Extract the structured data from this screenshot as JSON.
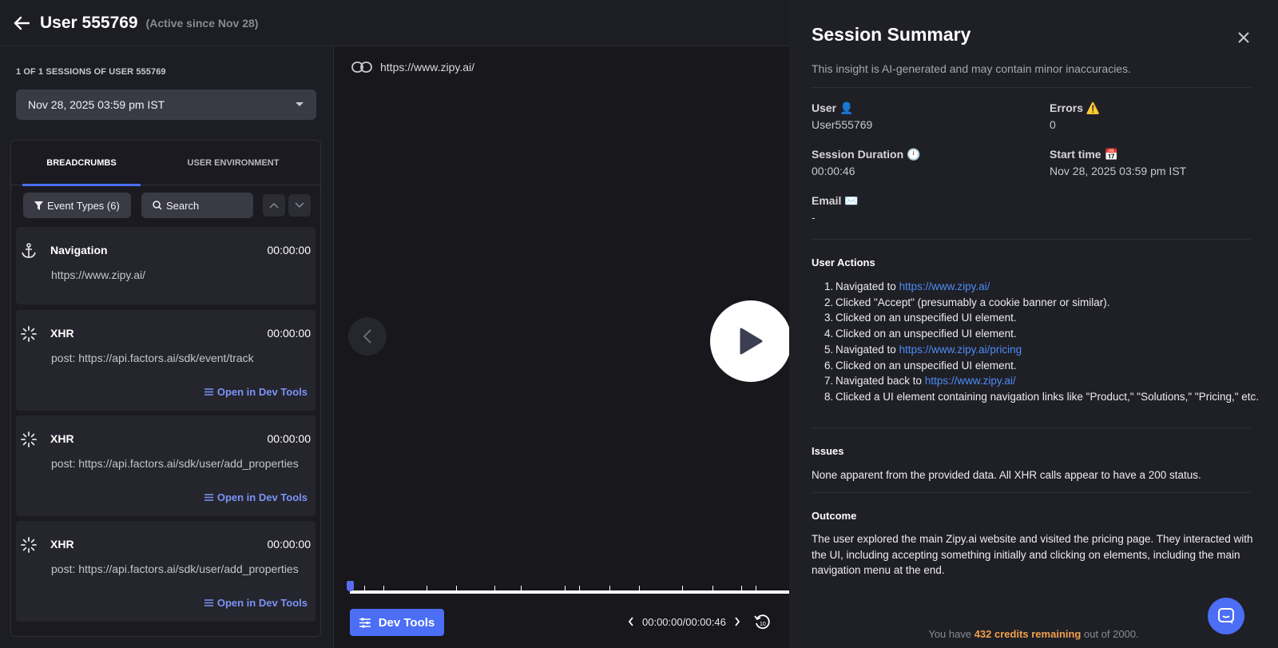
{
  "header": {
    "title": "User 555769",
    "active_since": "(Active since Nov 28)"
  },
  "left": {
    "sessions_label": "1 OF 1 SESSIONS OF USER 555769",
    "selected_session": "Nov 28, 2025 03:59 pm IST",
    "tabs": [
      {
        "label": "BREADCRUMBS",
        "active": true
      },
      {
        "label": "USER ENVIRONMENT",
        "active": false
      }
    ],
    "filter_label": "Event Types (6)",
    "search_label": "Search",
    "events": [
      {
        "icon": "anchor-icon",
        "title": "Navigation",
        "time": "00:00:00",
        "detail": "https://www.zipy.ai/",
        "link": ""
      },
      {
        "icon": "spinner-icon",
        "title": "XHR",
        "time": "00:00:00",
        "detail": "post: https://api.factors.ai/sdk/event/track",
        "link": "Open in Dev Tools"
      },
      {
        "icon": "spinner-icon",
        "title": "XHR",
        "time": "00:00:00",
        "detail": "post: https://api.factors.ai/sdk/user/add_properties",
        "link": "Open in Dev Tools"
      },
      {
        "icon": "spinner-icon",
        "title": "XHR",
        "time": "00:00:00",
        "detail": "post: https://api.factors.ai/sdk/user/add_properties",
        "link": "Open in Dev Tools"
      }
    ]
  },
  "player": {
    "url": "https://www.zipy.ai/",
    "dev_tools_label": "Dev Tools",
    "time_display": "00:00:00/00:00:46",
    "progress": 0
  },
  "summary": {
    "title": "Session Summary",
    "disclaimer": "This insight is AI-generated and may contain minor inaccuracies.",
    "user_label": "User 👤",
    "user_value": "User555769",
    "errors_label": "Errors ⚠️",
    "errors_value": "0",
    "duration_label": "Session Duration 🕛",
    "duration_value": "00:00:46",
    "start_label": "Start time 📅",
    "start_value": "Nov 28, 2025 03:59 pm IST",
    "email_label": "Email ✉️",
    "email_value": "-",
    "actions_title": "User Actions",
    "actions": [
      {
        "num": "1.",
        "text": "Navigated to ",
        "link": "https://www.zipy.ai/",
        "after": ""
      },
      {
        "num": "2.",
        "text": "Clicked \"Accept\" (presumably a cookie banner or similar).",
        "link": "",
        "after": ""
      },
      {
        "num": "3.",
        "text": "Clicked on an unspecified UI element.",
        "link": "",
        "after": ""
      },
      {
        "num": "4.",
        "text": "Clicked on an unspecified UI element.",
        "link": "",
        "after": ""
      },
      {
        "num": "5.",
        "text": "Navigated to ",
        "link": "https://www.zipy.ai/pricing",
        "after": ""
      },
      {
        "num": "6.",
        "text": "Clicked on an unspecified UI element.",
        "link": "",
        "after": ""
      },
      {
        "num": "7.",
        "text": "Navigated back to ",
        "link": "https://www.zipy.ai/",
        "after": ""
      },
      {
        "num": "8.",
        "text": "Clicked a UI element containing navigation links like \"Product,\" \"Solutions,\" \"Pricing,\" etc.",
        "link": "",
        "after": ""
      }
    ],
    "issues_title": "Issues",
    "issues_text": "None apparent from the provided data. All XHR calls appear to have a 200 status.",
    "outcome_title": "Outcome",
    "outcome_text": "The user explored the main Zipy.ai website and visited the pricing page. They interacted with the UI, including accepting something initially and clicking on elements, including the main navigation menu at the end.",
    "credits_prefix": "You have ",
    "credits_highlight": "432 credits remaining",
    "credits_suffix": " out of 2000."
  },
  "colors": {
    "accent": "#4b6ef5",
    "link": "#4c8df6",
    "credits": "#f0a04b"
  }
}
